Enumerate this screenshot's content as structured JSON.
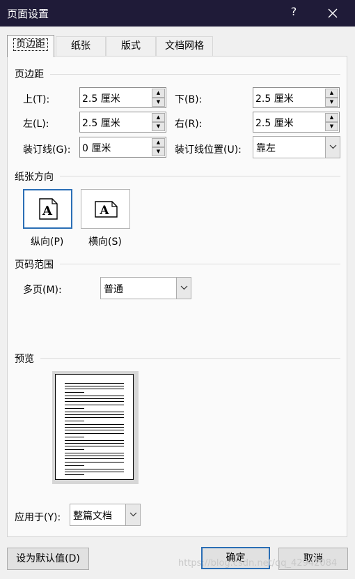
{
  "window": {
    "title": "页面设置",
    "help_label": "?",
    "close_icon": "close-icon"
  },
  "tabs": [
    {
      "label": "页边距",
      "active": true
    },
    {
      "label": "纸张",
      "active": false
    },
    {
      "label": "版式",
      "active": false
    },
    {
      "label": "文档网格",
      "active": false
    }
  ],
  "margins": {
    "section_title": "页边距",
    "top": {
      "label": "上(T):",
      "mnemonic": "T",
      "value": "2.5 厘米"
    },
    "bottom": {
      "label": "下(B):",
      "mnemonic": "B",
      "value": "2.5 厘米"
    },
    "left": {
      "label": "左(L):",
      "mnemonic": "L",
      "value": "2.5 厘米"
    },
    "right": {
      "label": "右(R):",
      "mnemonic": "R",
      "value": "2.5 厘米"
    },
    "gutter": {
      "label": "装订线(G):",
      "mnemonic": "G",
      "value": "0 厘米"
    },
    "gutter_position": {
      "label": "装订线位置(U):",
      "mnemonic": "U",
      "value": "靠左"
    }
  },
  "orientation": {
    "section_title": "纸张方向",
    "portrait": {
      "label": "纵向(P)",
      "selected": true,
      "icon_glyph": "A"
    },
    "landscape": {
      "label": "横向(S)",
      "selected": false,
      "icon_glyph": "A"
    }
  },
  "pages": {
    "section_title": "页码范围",
    "multiple_label": "多页(M):",
    "multiple_value": "普通"
  },
  "preview": {
    "section_title": "预览"
  },
  "apply_to": {
    "label": "应用于(Y):",
    "value": "整篇文档"
  },
  "buttons": {
    "set_default": "设为默认值(D)",
    "ok": "确定",
    "cancel": "取消"
  },
  "watermark": "https://blog.csdn.net/qq_42942084",
  "colors": {
    "titlebar": "#1f1b38",
    "accent": "#2a6eb5",
    "dialog_bg": "#f0f0f0"
  }
}
